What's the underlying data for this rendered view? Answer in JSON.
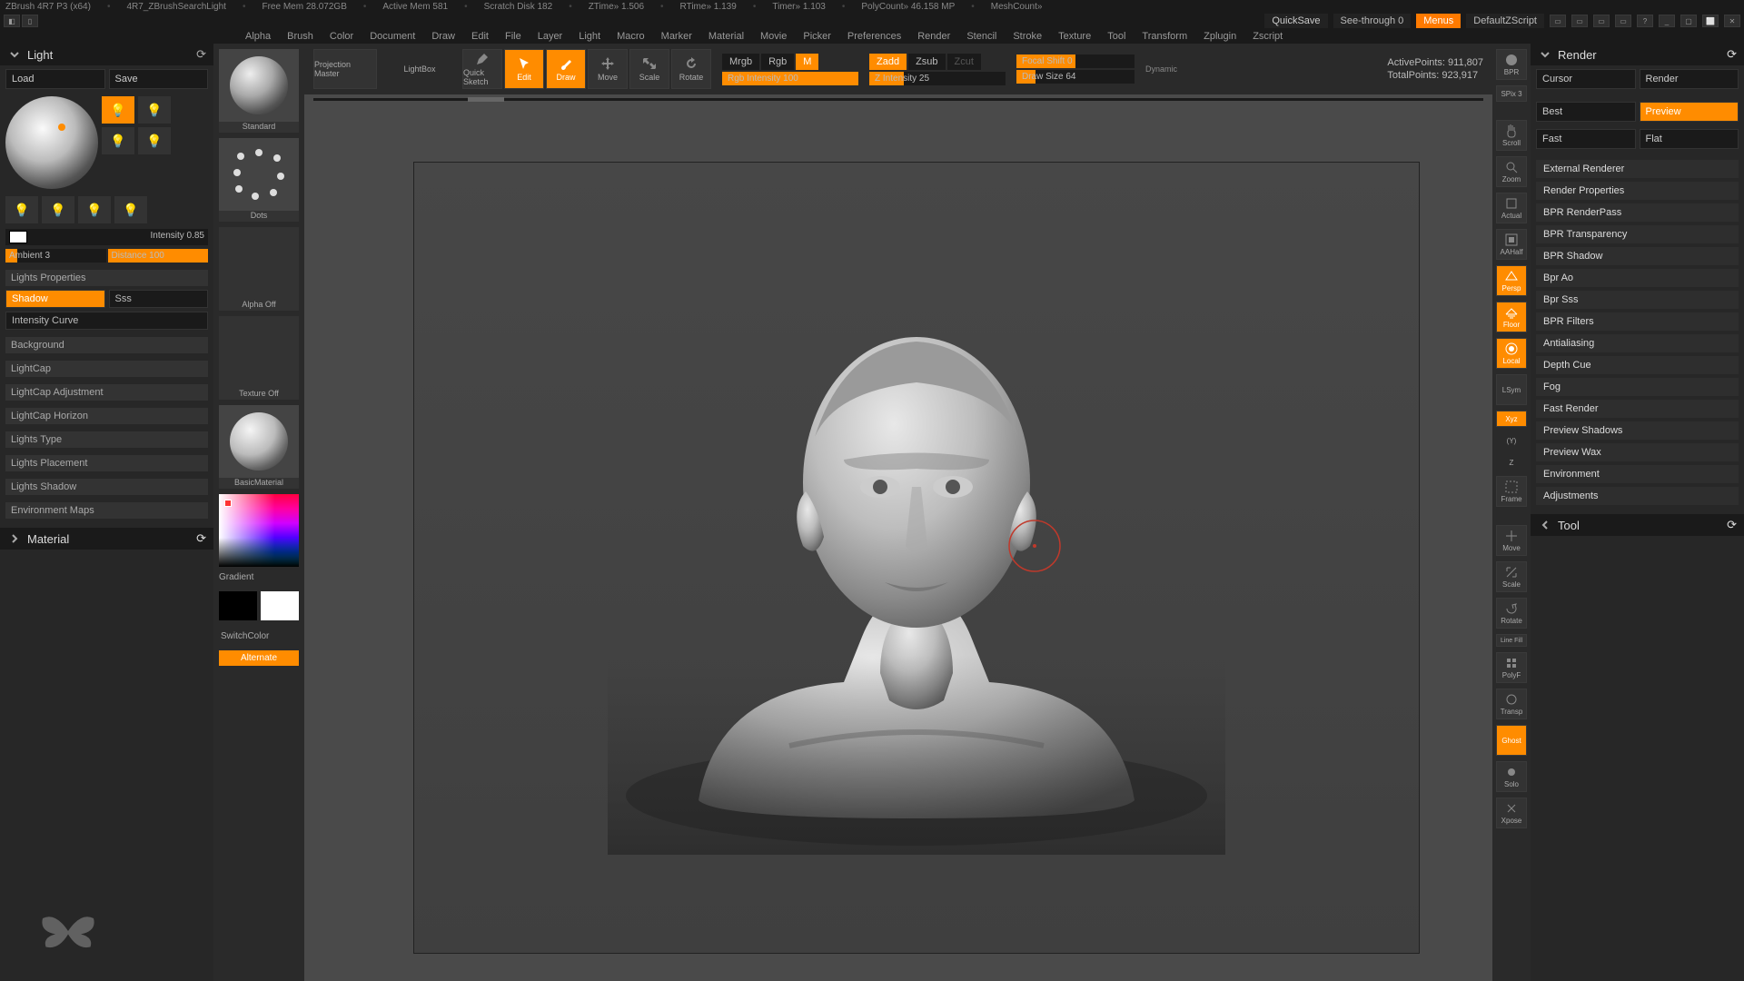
{
  "status": {
    "app": "ZBrush 4R7 P3 (x64)",
    "doc": "4R7_ZBrushSearchLight",
    "freeMem": "Free Mem 28.072GB",
    "activeMem": "Active Mem 581",
    "scratch": "Scratch Disk 182",
    "ztime": "ZTime» 1.506",
    "rtime": "RTime» 1.139",
    "timer": "Timer» 1.103",
    "polycount": "PolyCount» 46.158 MP",
    "meshcount": "MeshCount»"
  },
  "topIcons": {
    "quicksave": "QuickSave",
    "seethrough": "See-through  0",
    "menus": "Menus",
    "defaultScript": "DefaultZScript"
  },
  "menubar": [
    "Alpha",
    "Brush",
    "Color",
    "Document",
    "Draw",
    "Edit",
    "File",
    "Layer",
    "Light",
    "Macro",
    "Marker",
    "Material",
    "Movie",
    "Picker",
    "Preferences",
    "Render",
    "Stencil",
    "Stroke",
    "Texture",
    "Tool",
    "Transform",
    "Zplugin",
    "Zscript"
  ],
  "leftPanel": {
    "title": "Light",
    "load": "Load",
    "save": "Save",
    "intensity": "Intensity 0.85",
    "ambient": "Ambient 3",
    "distance": "Distance 100",
    "propsHdr": "Lights Properties",
    "shadow": "Shadow",
    "sss": "Sss",
    "intCurve": "Intensity Curve",
    "sections": [
      "Background",
      "LightCap",
      "LightCap Adjustment",
      "LightCap Horizon",
      "Lights Type",
      "Lights Placement",
      "Lights Shadow",
      "Environment Maps"
    ],
    "material": "Material"
  },
  "shelf": {
    "brush": "Standard",
    "stroke": "Dots",
    "alpha": "Alpha Off",
    "texture": "Texture Off",
    "material": "BasicMaterial",
    "gradient": "Gradient",
    "switchColor": "SwitchColor",
    "alternate": "Alternate"
  },
  "toolbar": {
    "projection": "Projection Master",
    "lightbox": "LightBox",
    "quickSketch": "Quick Sketch",
    "edit": "Edit",
    "draw": "Draw",
    "move": "Move",
    "scale": "Scale",
    "rotate": "Rotate",
    "mrgb": "Mrgb",
    "rgb": "Rgb",
    "m": "M",
    "rgbInt": "Rgb Intensity 100",
    "zadd": "Zadd",
    "zsub": "Zsub",
    "zcut": "Zcut",
    "zint": "Z Intensity 25",
    "focal": "Focal Shift 0",
    "drawSize": "Draw Size 64",
    "dynamic": "Dynamic",
    "activePts": "ActivePoints: 911,807",
    "totalPts": "TotalPoints: 923,917"
  },
  "side": {
    "bpr": "BPR",
    "spx": "SPix 3",
    "scroll": "Scroll",
    "zoom": "Zoom",
    "actual": "Actual",
    "aahalf": "AAHalf",
    "persp": "Persp",
    "floor": "Floor",
    "local": "Local",
    "lsym": "LSym",
    "xyz": "Xyz",
    "frame": "Frame",
    "move": "Move",
    "scale": "Scale",
    "rotate": "Rotate",
    "linefill": "Line Fill",
    "polyf": "PolyF",
    "transp": "Transp",
    "ghost": "Ghost",
    "solo": "Solo",
    "xpose": "Xpose"
  },
  "rightPanel": {
    "title": "Render",
    "cursor": "Cursor",
    "render": "Render",
    "best": "Best",
    "preview": "Preview",
    "fast": "Fast",
    "flat": "Flat",
    "items": [
      "External Renderer",
      "Render Properties",
      "BPR RenderPass",
      "BPR Transparency",
      "BPR Shadow",
      "Bpr Ao",
      "Bpr Sss",
      "BPR Filters",
      "Antialiasing",
      "Depth Cue",
      "Fog",
      "Fast Render",
      "Preview Shadows",
      "Preview Wax",
      "Environment",
      "Adjustments"
    ],
    "tool": "Tool"
  }
}
